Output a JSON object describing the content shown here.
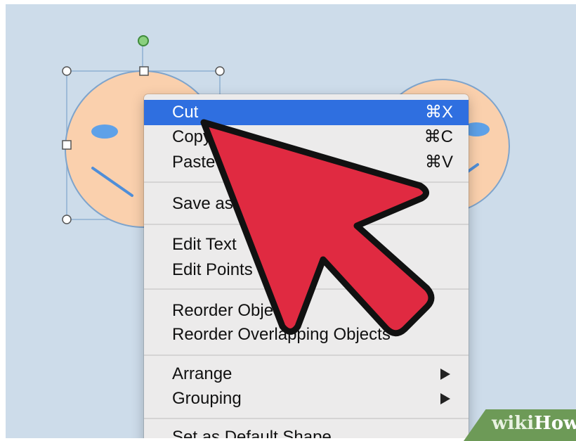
{
  "menu": {
    "items": [
      {
        "label": "Cut",
        "shortcut": "⌘X"
      },
      {
        "label": "Copy",
        "shortcut": "⌘C"
      },
      {
        "label": "Paste",
        "shortcut": "⌘V"
      },
      {
        "label": "Save as Picture...",
        "shortcut": ""
      },
      {
        "label": "Edit Text",
        "shortcut": ""
      },
      {
        "label": "Edit Points",
        "shortcut": ""
      },
      {
        "label": "Reorder Objects",
        "shortcut": ""
      },
      {
        "label": "Reorder Overlapping Objects",
        "shortcut": ""
      },
      {
        "label": "Arrange",
        "shortcut": ""
      },
      {
        "label": "Grouping",
        "shortcut": ""
      },
      {
        "label": "Set as Default Shape",
        "shortcut": ""
      }
    ],
    "highlighted_item": "Cut"
  },
  "watermark": {
    "wiki": "wiki",
    "how": "How"
  },
  "icons": {
    "submenu": "chevron-right-icon",
    "pointer": "cursor-arrow-icon"
  },
  "colors": {
    "highlight": "#2f6fe0",
    "canvas": "#cddcea",
    "face_fill": "#fad0ad",
    "pointer_fill": "#e02a41",
    "watermark": "#6d9a57"
  }
}
